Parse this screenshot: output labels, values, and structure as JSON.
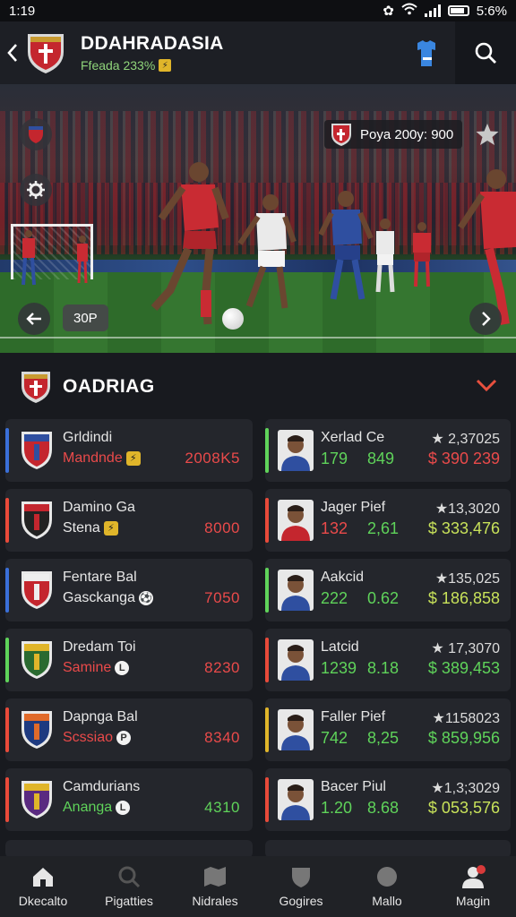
{
  "status": {
    "time": "1:19",
    "battery": "5:6%"
  },
  "header": {
    "title": "DDAHRADASIA",
    "subtitle": "Ffeada 233%",
    "badge": "⚡"
  },
  "hero": {
    "score_text": "Poya 200y: 900",
    "tag": "30P"
  },
  "section": {
    "title": "OADRIAG"
  },
  "clubs": [
    {
      "name1": "Grldindi",
      "name2": "Mandnde",
      "tag": "⚡",
      "tag_style": "y",
      "value": "2008K5",
      "value_color": "red",
      "accent": "#3a6fd8",
      "name2_color": "red"
    },
    {
      "name1": "Damino Ga",
      "name2": "Stena",
      "tag": "⚡",
      "tag_style": "y",
      "value": "8000",
      "value_color": "red",
      "accent": "#e84a3a",
      "name2_color": "plain"
    },
    {
      "name1": "Fentare Bal",
      "name2": "Gasckanga",
      "tag": "⚽",
      "tag_style": "w",
      "value": "7050",
      "value_color": "red",
      "accent": "#3a6fd8",
      "name2_color": "plain"
    },
    {
      "name1": "Dredam Toi",
      "name2": "Samine",
      "tag": "L",
      "tag_style": "w",
      "value": "8230",
      "value_color": "red",
      "accent": "#5fd35a",
      "name2_color": "red"
    },
    {
      "name1": "Dapnga Bal",
      "name2": "Scssiao",
      "tag": "P",
      "tag_style": "w",
      "value": "8340",
      "value_color": "red",
      "accent": "#e84a3a",
      "name2_color": "red"
    },
    {
      "name1": "Camdurians",
      "name2": "Ananga",
      "tag": "L",
      "tag_style": "w",
      "value": "4310",
      "value_color": "green",
      "accent": "#e84a3a",
      "name2_color": "green"
    }
  ],
  "players": [
    {
      "name": "Xerlad Ce",
      "s1": "179",
      "s2": "849",
      "stat": "★ 2,37025",
      "money": "$ 390 239",
      "s_color": "green",
      "money_color": "red",
      "accent": "#5fd35a"
    },
    {
      "name": "Jager Pief",
      "s1": "132",
      "s2": "2,61",
      "stat": "★13,3020",
      "money": "$ 333,476",
      "s_color": "red",
      "money_color": "lime",
      "accent": "#e84a3a"
    },
    {
      "name": "Aakcid",
      "s1": "222",
      "s2": "0.62",
      "stat": "★135,025",
      "money": "$ 186,858",
      "s_color": "green",
      "money_color": "lime",
      "accent": "#5fd35a"
    },
    {
      "name": "Latcid",
      "s1": "1239",
      "s2": "8.18",
      "stat": "★ 17,3070",
      "money": "$ 389,453",
      "s_color": "green",
      "money_color": "green",
      "accent": "#e84a3a"
    },
    {
      "name": "Faller Pief",
      "s1": "742",
      "s2": "8,25",
      "stat": "★1158023",
      "money": "$ 859,956",
      "s_color": "green",
      "money_color": "green",
      "accent": "#e0b52a"
    },
    {
      "name": "Bacer Piul",
      "s1": "1.20",
      "s2": "8.68",
      "stat": "★1,3;3029",
      "money": "$ 053,576",
      "s_color": "green",
      "money_color": "lime",
      "accent": "#e84a3a"
    }
  ],
  "nav": [
    {
      "label": "Dkecalto",
      "icon": "home-icon"
    },
    {
      "label": "Pigatties",
      "icon": "search-icon"
    },
    {
      "label": "Nidrales",
      "icon": "map-icon"
    },
    {
      "label": "Gogires",
      "icon": "shield-icon"
    },
    {
      "label": "Mallo",
      "icon": "ball-icon"
    },
    {
      "label": "Magin",
      "icon": "profile-icon"
    }
  ]
}
